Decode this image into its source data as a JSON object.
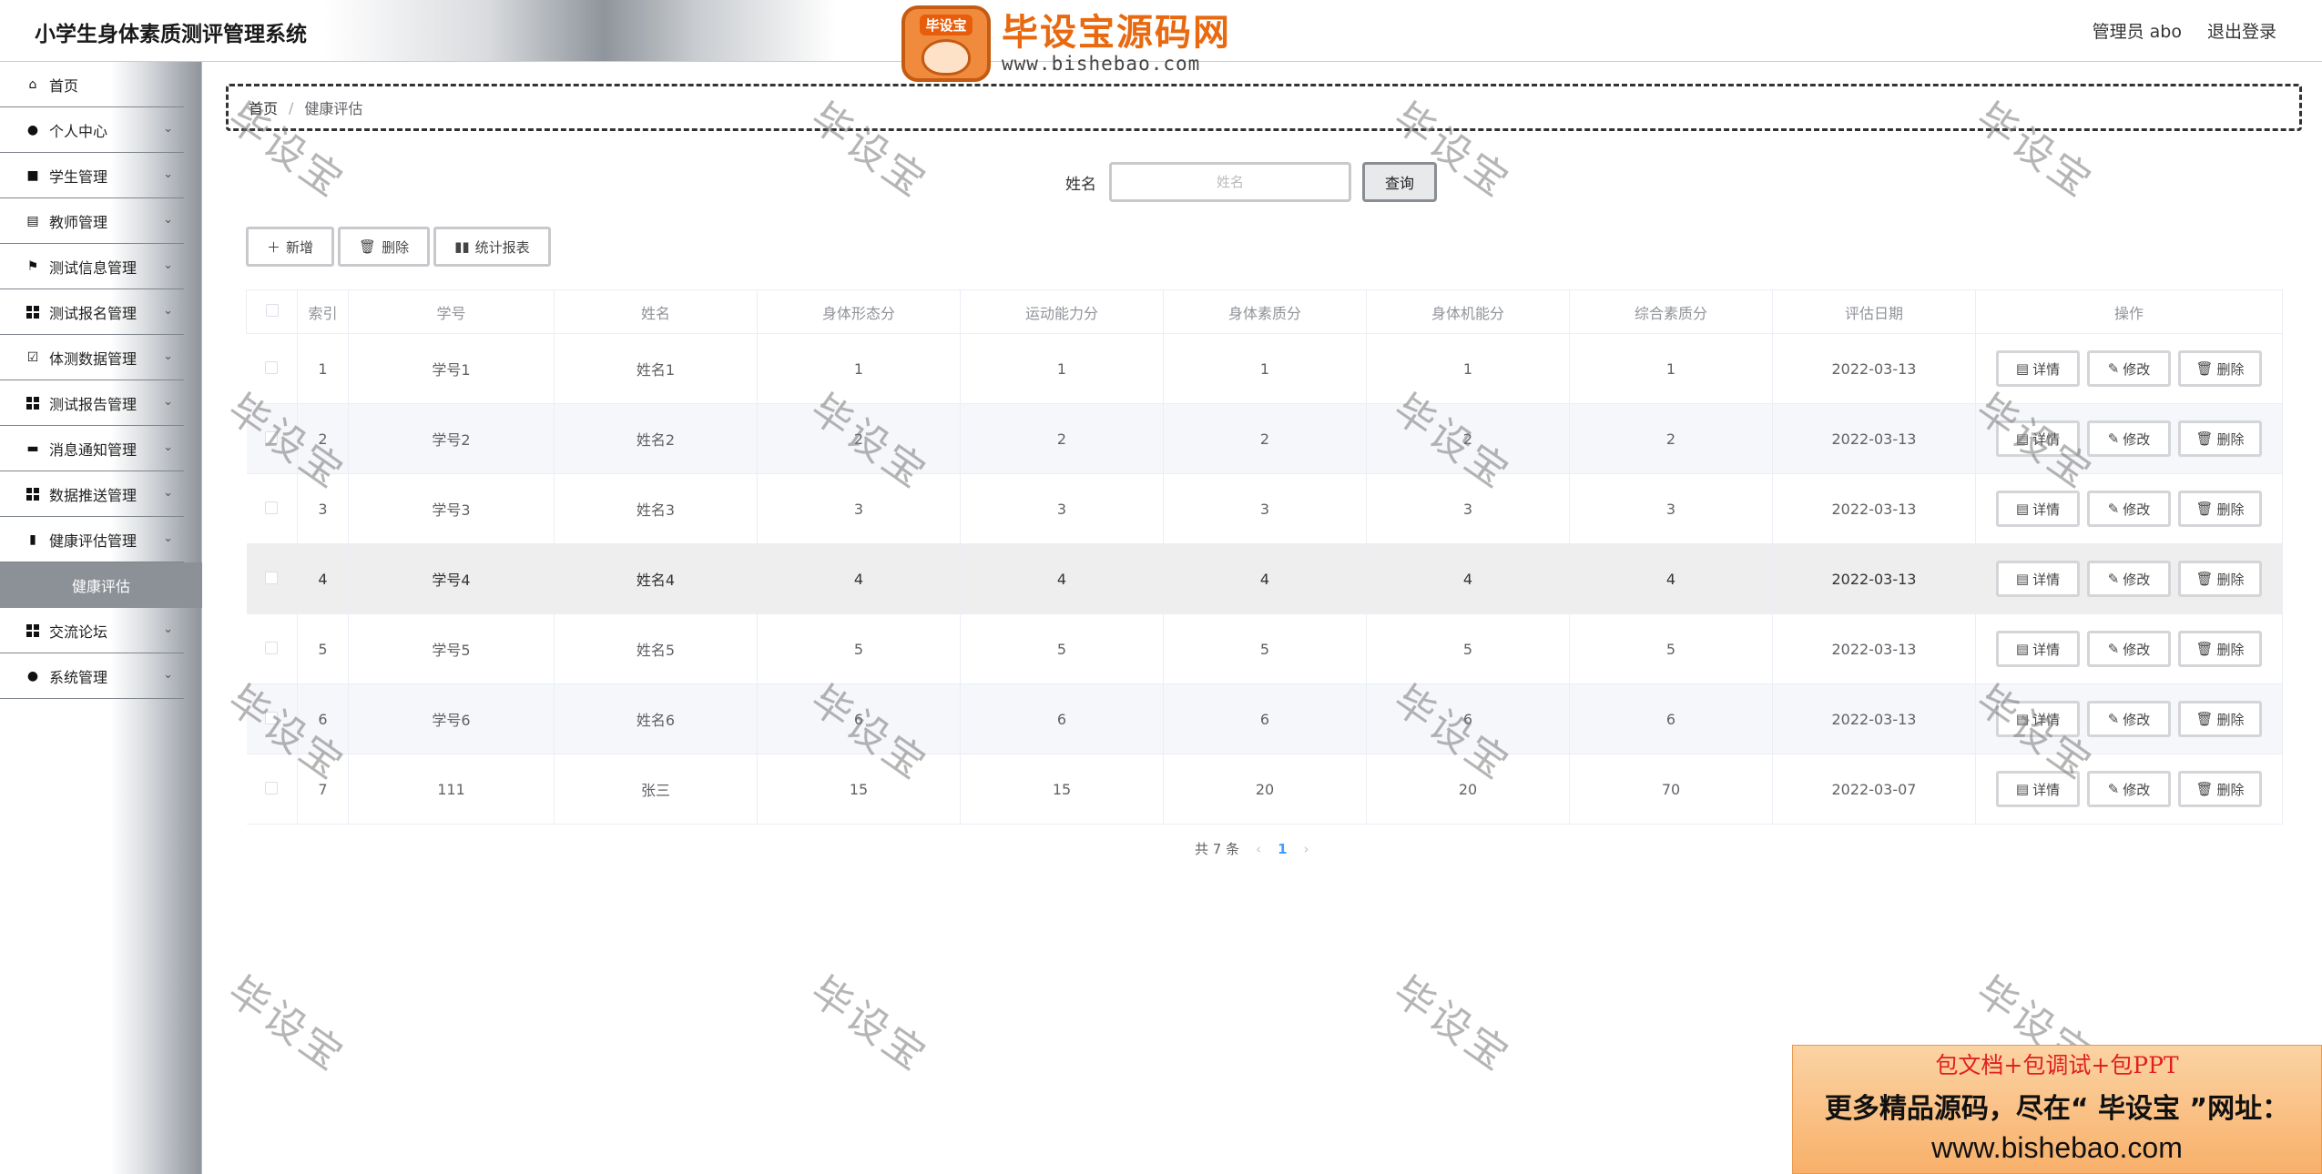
{
  "header": {
    "app_title": "小学生身体素质测评管理系统",
    "admin_label": "管理员 abo",
    "logout_label": "退出登录",
    "logo_badge": "毕设宝",
    "logo_text": "毕设宝源码网",
    "logo_url": "www.bishebao.com"
  },
  "sidebar": {
    "items": [
      {
        "label": "首页",
        "icon": "home-icon"
      },
      {
        "label": "个人中心",
        "icon": "user-icon"
      },
      {
        "label": "学生管理",
        "icon": "video-icon"
      },
      {
        "label": "教师管理",
        "icon": "clipboard-icon"
      },
      {
        "label": "测试信息管理",
        "icon": "flag-icon"
      },
      {
        "label": "测试报名管理",
        "icon": "grid-icon"
      },
      {
        "label": "体测数据管理",
        "icon": "checklist-icon"
      },
      {
        "label": "测试报告管理",
        "icon": "grid-icon"
      },
      {
        "label": "消息通知管理",
        "icon": "monitor-icon"
      },
      {
        "label": "数据推送管理",
        "icon": "grid-icon"
      },
      {
        "label": "健康评估管理",
        "icon": "bar-chart-icon"
      },
      {
        "label": "交流论坛",
        "icon": "grid-icon"
      },
      {
        "label": "系统管理",
        "icon": "user-icon"
      }
    ],
    "active_sub": "健康评估"
  },
  "breadcrumb": {
    "home": "首页",
    "sep": "/",
    "current": "健康评估"
  },
  "search": {
    "label": "姓名",
    "placeholder": "姓名",
    "button": "查询"
  },
  "actions": {
    "add": "新增",
    "delete": "删除",
    "report": "统计报表"
  },
  "table": {
    "headers": [
      "索引",
      "学号",
      "姓名",
      "身体形态分",
      "运动能力分",
      "身体素质分",
      "身体机能分",
      "综合素质分",
      "评估日期",
      "操作"
    ],
    "row_actions": {
      "detail": "详情",
      "edit": "修改",
      "delete": "删除"
    },
    "rows": [
      [
        "1",
        "学号1",
        "姓名1",
        "1",
        "1",
        "1",
        "1",
        "1",
        "2022-03-13"
      ],
      [
        "2",
        "学号2",
        "姓名2",
        "2",
        "2",
        "2",
        "2",
        "2",
        "2022-03-13"
      ],
      [
        "3",
        "学号3",
        "姓名3",
        "3",
        "3",
        "3",
        "3",
        "3",
        "2022-03-13"
      ],
      [
        "4",
        "学号4",
        "姓名4",
        "4",
        "4",
        "4",
        "4",
        "4",
        "2022-03-13"
      ],
      [
        "5",
        "学号5",
        "姓名5",
        "5",
        "5",
        "5",
        "5",
        "5",
        "2022-03-13"
      ],
      [
        "6",
        "学号6",
        "姓名6",
        "6",
        "6",
        "6",
        "6",
        "6",
        "2022-03-13"
      ],
      [
        "7",
        "111",
        "张三",
        "15",
        "15",
        "20",
        "20",
        "70",
        "2022-03-07"
      ]
    ]
  },
  "pagination": {
    "total": "共 7 条",
    "current": "1"
  },
  "watermark": "毕设宝",
  "ad": {
    "line1": "包文档+包调试+包PPT",
    "line2": "更多精品源码，尽在“ 毕设宝 ”网址：",
    "line3": "www.bishebao.com"
  }
}
